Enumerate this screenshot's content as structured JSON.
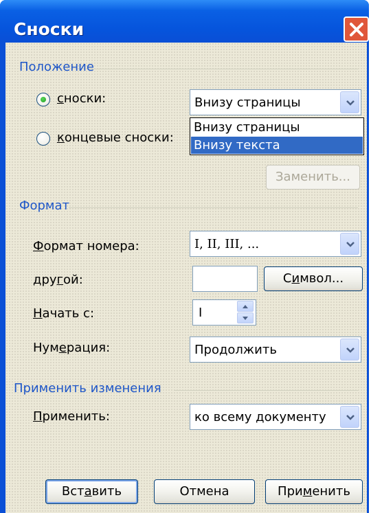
{
  "window": {
    "title": "Сноски"
  },
  "position_group": {
    "title": "Положение",
    "footnotes": {
      "label_ul": "с",
      "label_rest": "носки:",
      "selected": true,
      "value": "Внизу страницы"
    },
    "endnotes": {
      "label_ul": "к",
      "label_rest": "онцевые сноски:",
      "selected": false
    },
    "dropdown_options": [
      "Внизу страницы",
      "Внизу текста"
    ],
    "replace_button": "Заменить..."
  },
  "format_group": {
    "title": "Формат",
    "number_format": {
      "label_ul": "Ф",
      "label_rest": "ормат номера:",
      "value": "I, II, III, ..."
    },
    "custom": {
      "label_pre": "дру",
      "label_ul": "г",
      "label_rest": "ой:",
      "value": ""
    },
    "symbol_button": {
      "pre": "С",
      "ul": "и",
      "rest": "мвол..."
    },
    "start_at": {
      "label_ul": "Н",
      "label_rest": "ачать с:",
      "value": "I"
    },
    "numbering": {
      "label_pre": "Нум",
      "label_ul": "е",
      "label_rest": "рация:",
      "value": "Продолжить"
    }
  },
  "apply_group": {
    "title": "Применить изменения",
    "apply_to": {
      "label_ul": "П",
      "label_rest": "рименить:",
      "value": "ко всему документу"
    }
  },
  "buttons": {
    "insert": {
      "pre": "Вст",
      "ul": "а",
      "rest": "вить"
    },
    "cancel": "Отмена",
    "apply": {
      "pre": "При",
      "ul": "м",
      "rest": "енить"
    }
  }
}
